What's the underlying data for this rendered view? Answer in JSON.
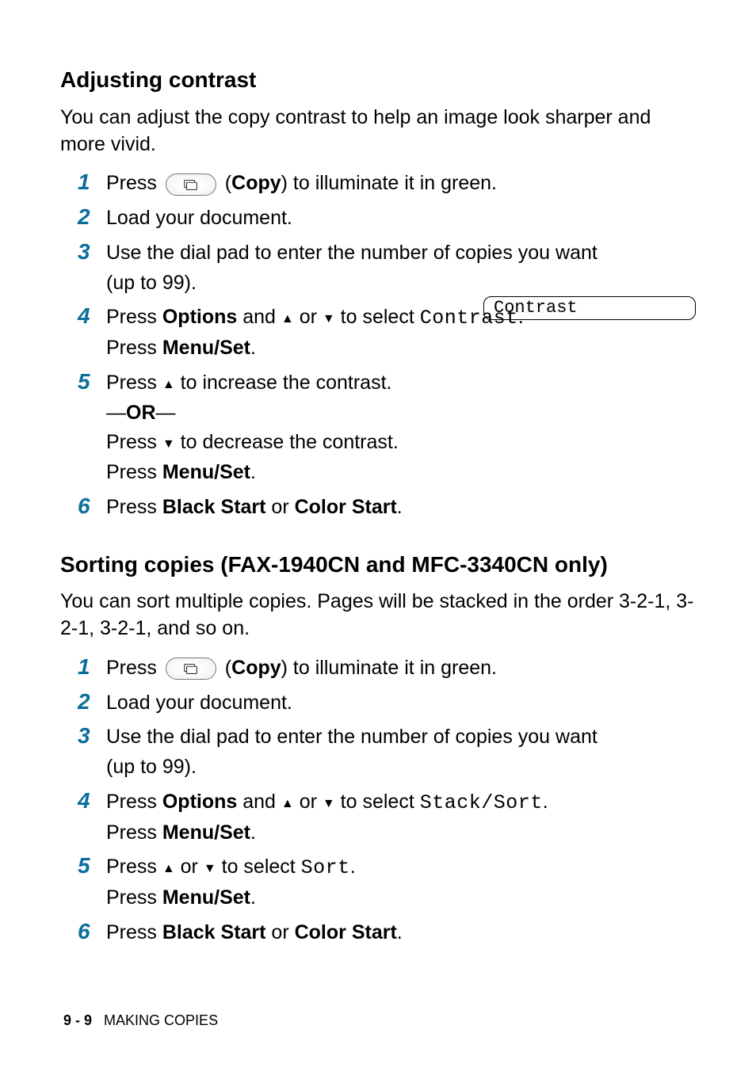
{
  "section1": {
    "heading": "Adjusting contrast",
    "intro": "You can adjust the copy contrast to help an image look sharper and more vivid.",
    "steps": {
      "s1": {
        "num": "1",
        "pre": "Press ",
        "btn_label": "Copy",
        "post": ") to illuminate it in green."
      },
      "s2": {
        "num": "2",
        "text": "Load your document."
      },
      "s3": {
        "num": "3",
        "line1": "Use the dial pad to enter the number of copies you want",
        "line2": "(up to 99)."
      },
      "s4": {
        "num": "4",
        "pre": "Press ",
        "options": "Options",
        "mid1": " and ",
        "or_word": " or ",
        "mid2": " to select ",
        "value": "Contrast",
        "period": ".",
        "press": "Press ",
        "menuset": "Menu/Set",
        "period2": "."
      },
      "s5": {
        "num": "5",
        "pre": "Press ",
        "post": " to increase the contrast.",
        "or_dash1": "—",
        "or_word": "OR",
        "or_dash2": "—",
        "pre2": "Press ",
        "post2": " to decrease the contrast.",
        "press": "Press ",
        "menuset": "Menu/Set",
        "period": "."
      },
      "s6": {
        "num": "6",
        "pre": "Press ",
        "bs": "Black Start",
        "or": " or ",
        "cs": "Color Start",
        "period": "."
      }
    },
    "lcd_text": "Contrast"
  },
  "section2": {
    "heading": "Sorting copies (FAX-1940CN and MFC-3340CN only)",
    "intro": "You can sort multiple copies. Pages will be stacked in the order 3-2-1, 3-2-1, 3-2-1, and so on.",
    "steps": {
      "s1": {
        "num": "1",
        "pre": "Press ",
        "btn_label": "Copy",
        "post": ") to illuminate it in green."
      },
      "s2": {
        "num": "2",
        "text": "Load your document."
      },
      "s3": {
        "num": "3",
        "line1": "Use the dial pad to enter the number of copies you want",
        "line2": "(up to 99)."
      },
      "s4": {
        "num": "4",
        "pre": "Press ",
        "options": "Options",
        "mid1": " and ",
        "or_word": " or ",
        "mid2": " to select ",
        "value": "Stack/Sort",
        "period": ".",
        "press": "Press ",
        "menuset": "Menu/Set",
        "period2": "."
      },
      "s5": {
        "num": "5",
        "pre": "Press ",
        "or_word": " or ",
        "mid": " to select ",
        "value": "Sort",
        "period": ".",
        "press": "Press ",
        "menuset": "Menu/Set",
        "period2": "."
      },
      "s6": {
        "num": "6",
        "pre": "Press ",
        "bs": "Black Start",
        "or": " or ",
        "cs": "Color Start",
        "period": "."
      }
    }
  },
  "footer": {
    "page": "9 - 9",
    "title": "MAKING COPIES"
  }
}
